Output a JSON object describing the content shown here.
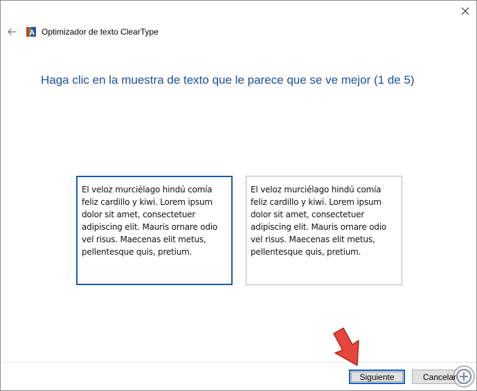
{
  "window": {
    "title": "Optimizador de texto ClearType",
    "close_icon": "close-icon",
    "back_icon": "back-arrow-icon",
    "app_icon": "cleartype-icon"
  },
  "main": {
    "heading": "Haga clic en la muestra de texto que le parece que se ve mejor (1 de 5)",
    "samples": [
      {
        "text": "El veloz murciélago hindú comía feliz cardillo y kiwi. Lorem ipsum dolor sit amet, consectetuer adipiscing elit. Mauris ornare odio vel risus. Maecenas elit metus, pellentesque quis, pretium.",
        "selected": true
      },
      {
        "text": "El veloz murciélago hindú comía feliz cardillo y kiwi. Lorem ipsum dolor sit amet, consectetuer adipiscing elit. Mauris ornare odio vel risus. Maecenas elit metus, pellentesque quis, pretium.",
        "selected": false
      }
    ]
  },
  "footer": {
    "next_label": "Siguiente",
    "cancel_label": "Cancelar"
  },
  "colors": {
    "heading": "#1b4e9a",
    "selected_border": "#1c5ca8",
    "arrow": "#e8453c"
  }
}
